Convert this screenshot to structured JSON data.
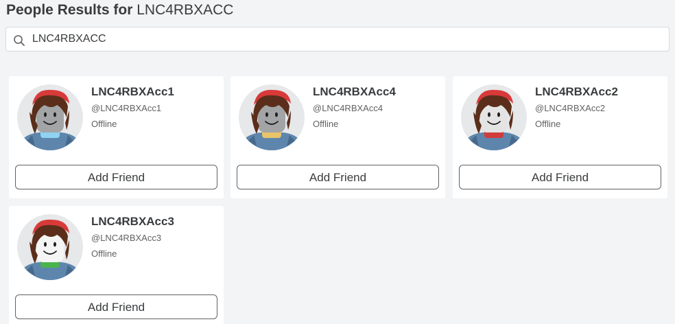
{
  "header": {
    "prefix": "People Results for",
    "search_term": "LNC4RBXACC"
  },
  "search": {
    "value": "LNC4RBXACC",
    "icon": "search-icon"
  },
  "results": [
    {
      "display_name": "LNC4RBXAcc1",
      "username": "@LNC4RBXAcc1",
      "presence": "Offline",
      "button_label": "Add Friend",
      "skin_color": "#a3a4a6",
      "neck_color": "#8fd3f0"
    },
    {
      "display_name": "LNC4RBXAcc4",
      "username": "@LNC4RBXAcc4",
      "presence": "Offline",
      "button_label": "Add Friend",
      "skin_color": "#a3a4a6",
      "neck_color": "#e8c46a"
    },
    {
      "display_name": "LNC4RBXAcc2",
      "username": "@LNC4RBXAcc2",
      "presence": "Offline",
      "button_label": "Add Friend",
      "skin_color": "#e4e4e4",
      "neck_color": "#d23c3c"
    },
    {
      "display_name": "LNC4RBXAcc3",
      "username": "@LNC4RBXAcc3",
      "presence": "Offline",
      "button_label": "Add Friend",
      "skin_color": "#f5f5f5",
      "neck_color": "#4bb34b"
    }
  ],
  "colors": {
    "background": "#f2f4f5",
    "card": "#ffffff",
    "text": "#393b3d",
    "secondary_text": "#606162",
    "hood": "#d83a3a",
    "hair": "#5a2e1a",
    "shirt": "#5e86ad"
  }
}
